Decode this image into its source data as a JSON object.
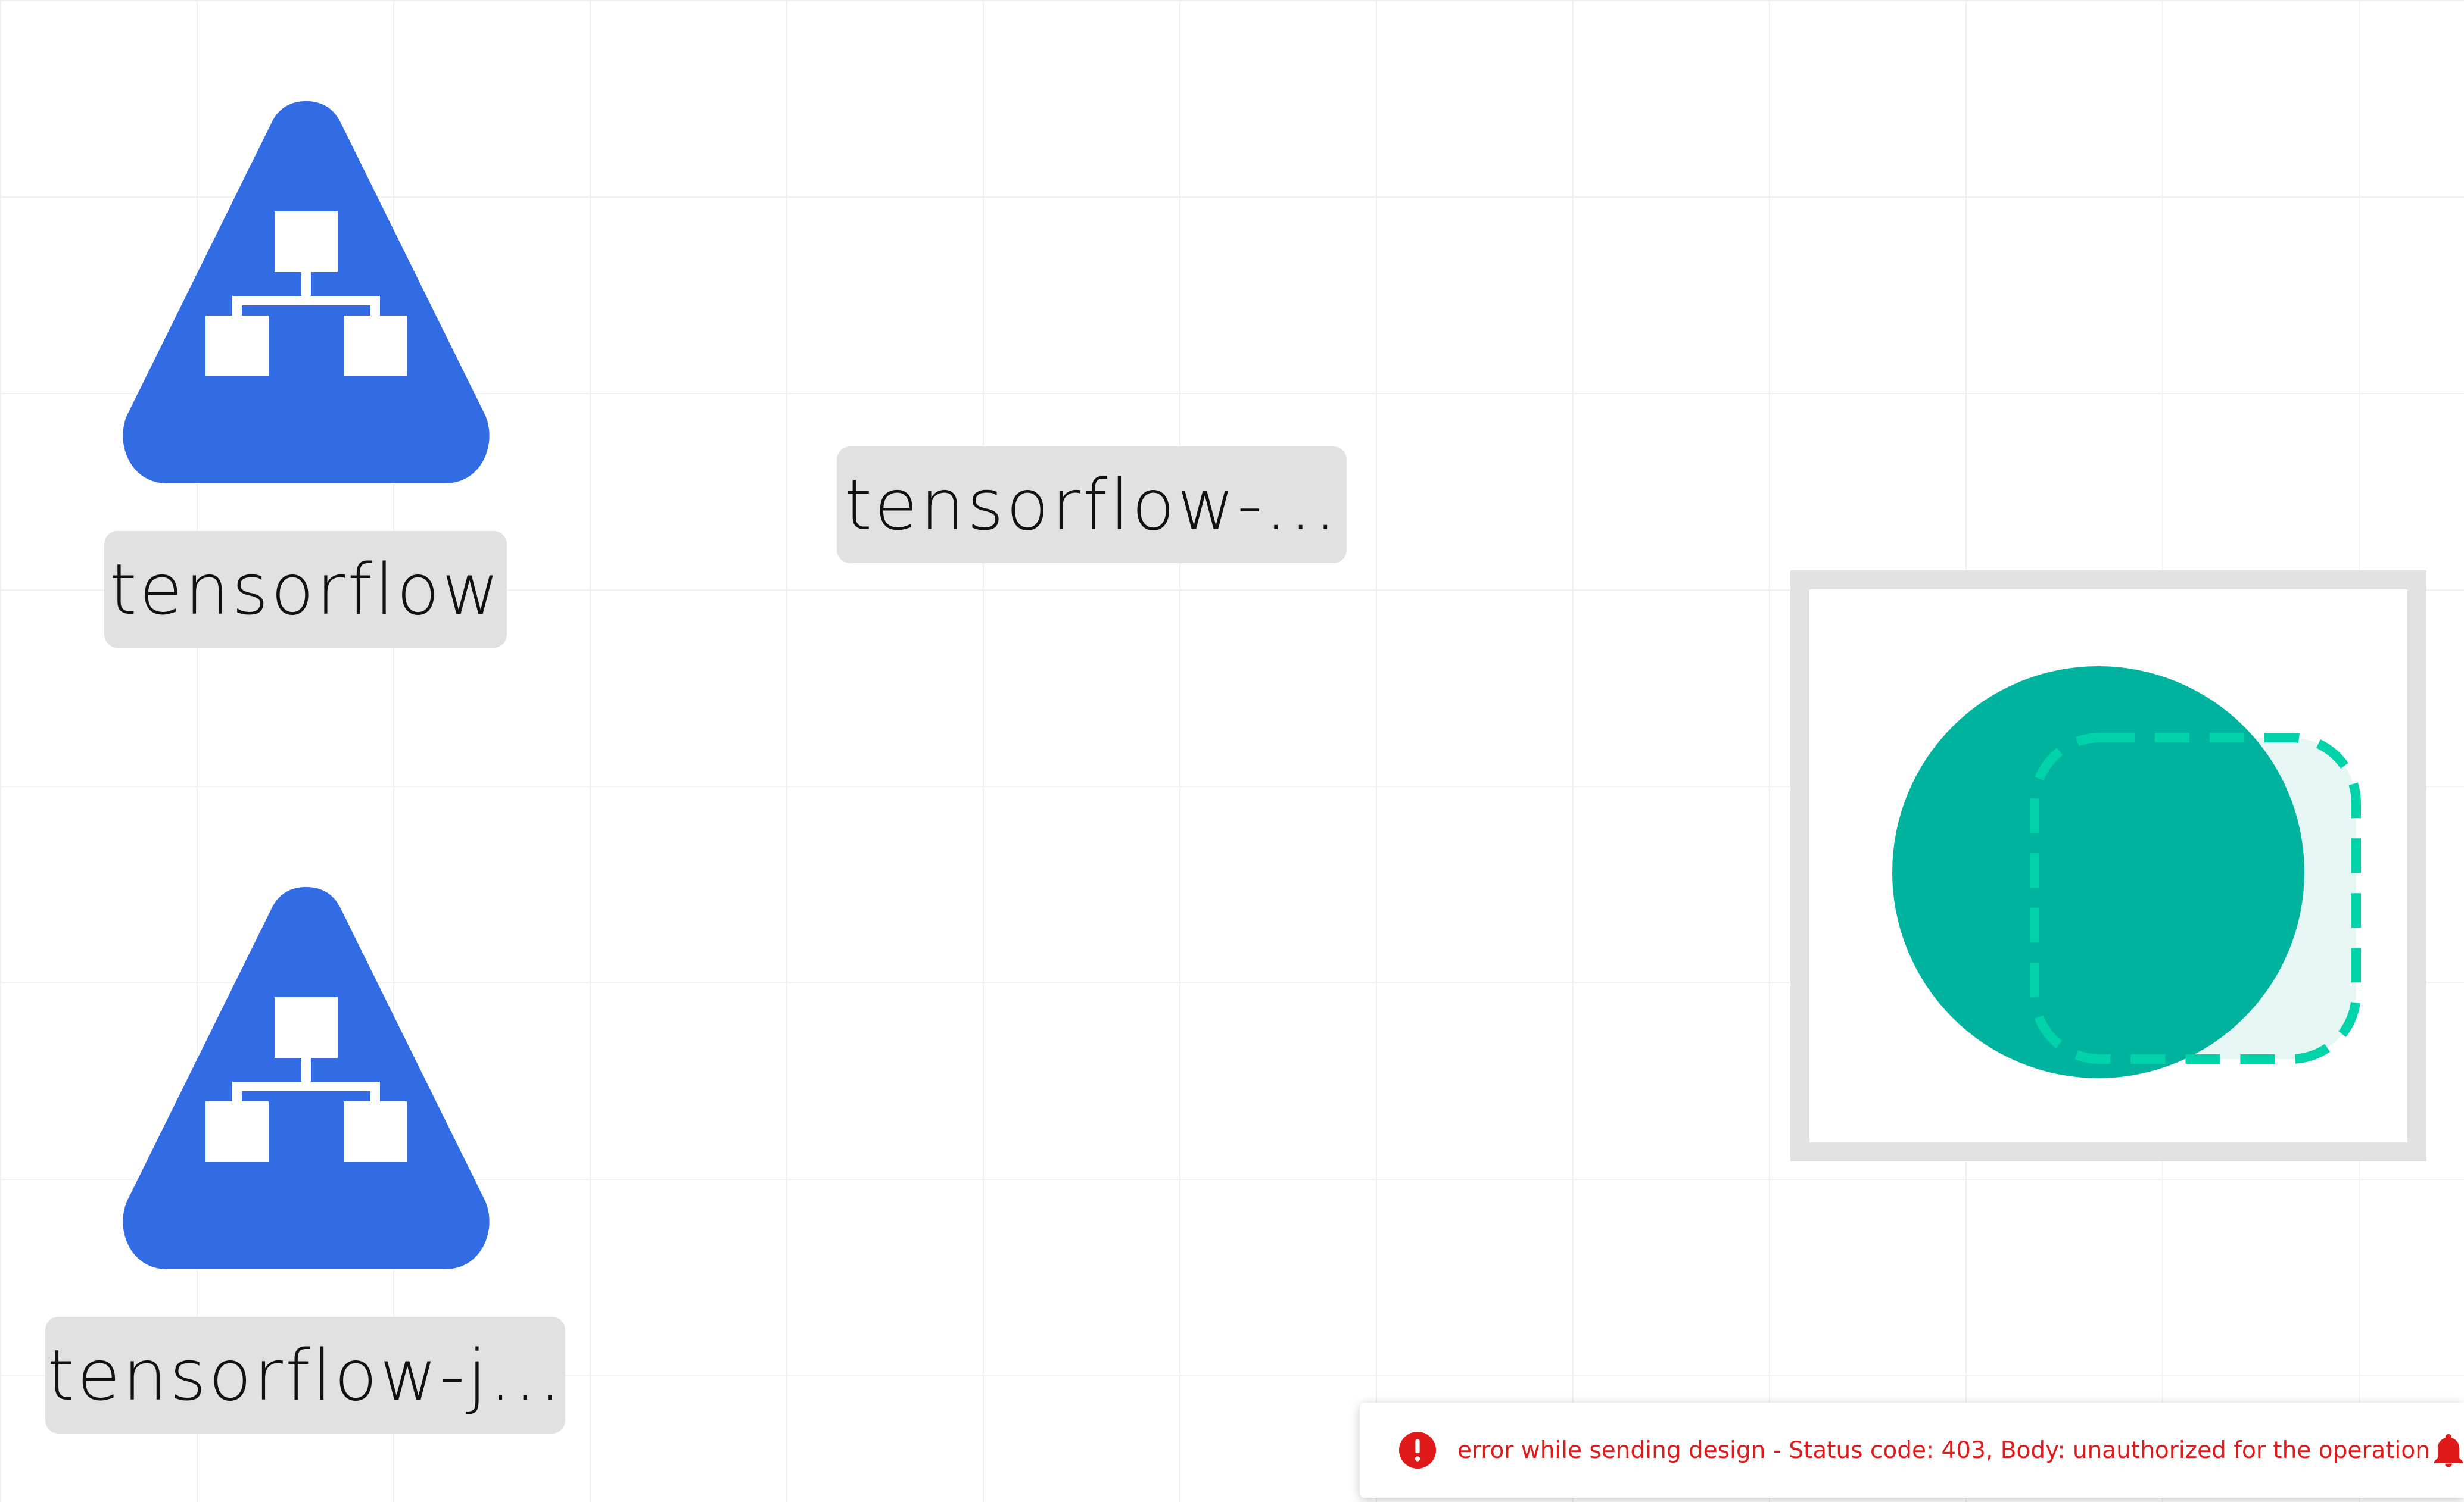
{
  "canvas": {
    "nodes": [
      {
        "label": "tensorflow",
        "icon": "kubernetes-service-icon",
        "color": "#326ce5"
      },
      {
        "label": "tensorflow-...",
        "icon": "none"
      },
      {
        "label": "tensorflow-j...",
        "icon": "kubernetes-service-icon",
        "color": "#326ce5"
      }
    ],
    "group": {
      "icon": "meshery-group-icon",
      "colors": {
        "circle": "#00b39f",
        "dashed": "#00d3a9",
        "fill": "#e5f6f3",
        "frame": "#e2e2e2"
      }
    }
  },
  "toast": {
    "message": "error while sending design - Status code: 403, Body: unauthorized for the operation",
    "icon": "error-icon",
    "action_icon": "bell-icon",
    "color": "#e01a1a"
  }
}
